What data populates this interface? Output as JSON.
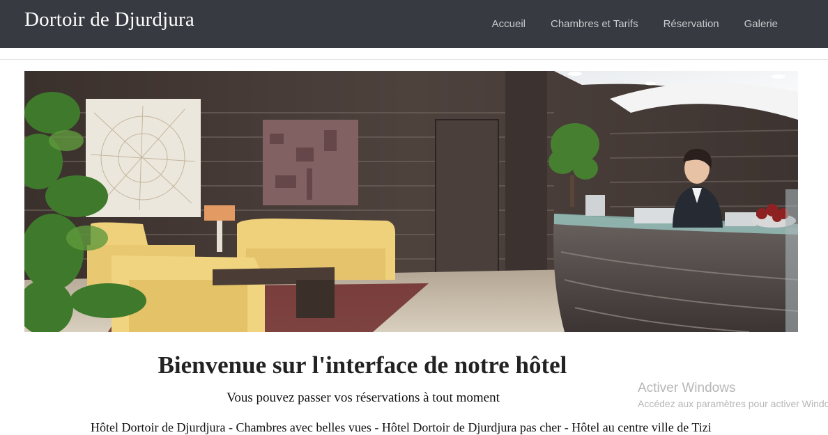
{
  "navbar": {
    "brand": "Dortoir de Djurdjura",
    "links": [
      "Accueil",
      "Chambres et Tarifs",
      "Réservation",
      "Galerie"
    ]
  },
  "hero": {
    "image": "hotel-lobby-reception-photo"
  },
  "content": {
    "welcome": "Bienvenue sur l'interface de notre hôtel",
    "subtitle": "Vous pouvez passer vos réservations à tout moment",
    "seo_line": "Hôtel Dortoir de Djurdjura - Chambres avec belles vues - Hôtel Dortoir de Djurdjura pas cher - Hôtel au centre ville de Tizi"
  },
  "watermark": {
    "title": "Activer Windows",
    "subtitle": "Accédez aux paramètres pour activer Windows."
  },
  "colors": {
    "navbar_bg": "#373a40",
    "nav_link": "#c9cbce",
    "watermark": "#b6b6b6"
  }
}
